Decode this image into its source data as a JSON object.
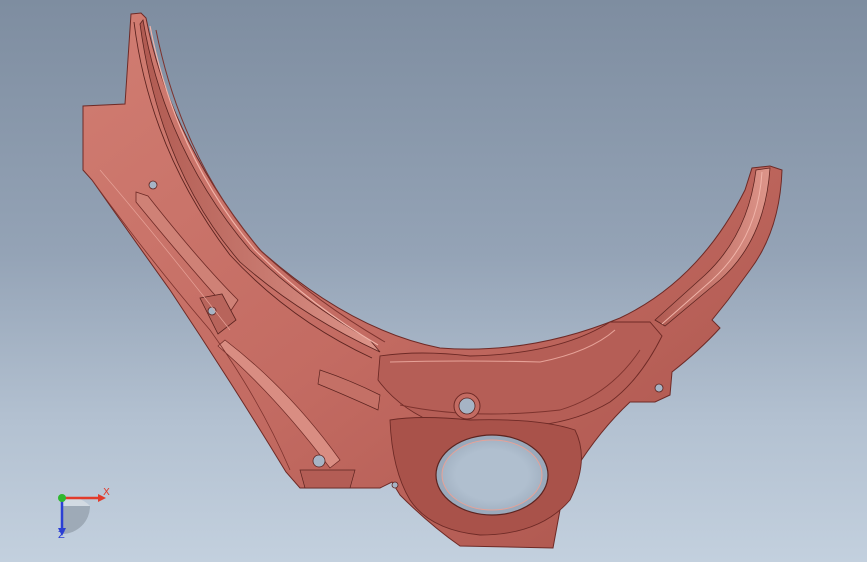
{
  "window": {
    "title": ""
  },
  "viewport": {
    "background_top": "#7e8da0",
    "background_bottom": "#c3d0de",
    "part_color": "#c36b62",
    "part_shade": "#8e3d37",
    "part_highlight": "#e29a8f"
  },
  "triad": {
    "x_label": "X",
    "z_label": "Z",
    "x_color": "#e23b2b",
    "y_color": "#2fb82f",
    "z_color": "#2b3fd4"
  }
}
